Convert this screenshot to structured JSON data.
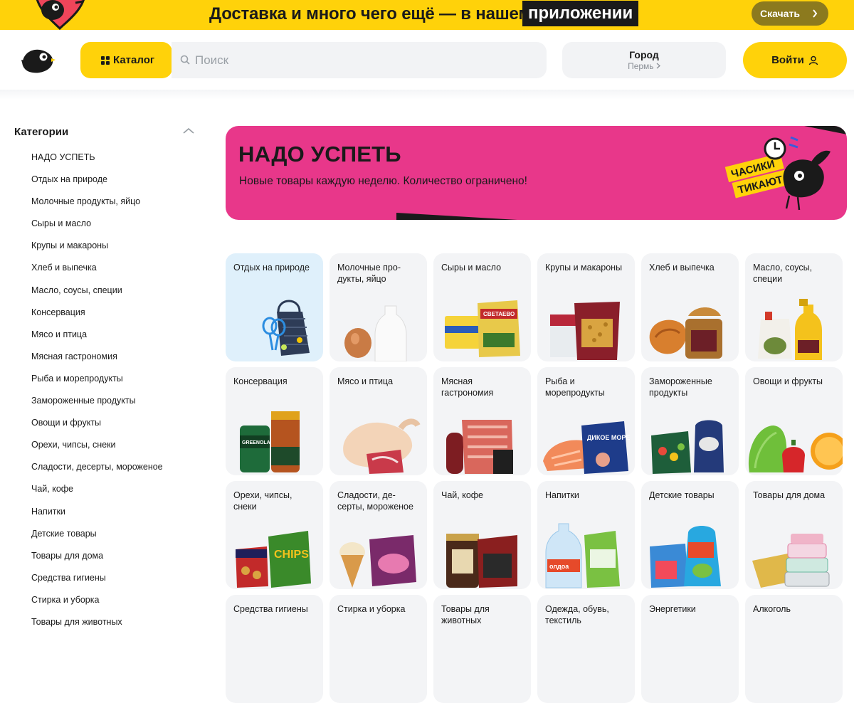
{
  "promo": {
    "text": "Доставка и много чего ещё — в нашем",
    "highlight": "приложении",
    "button": "Скачать"
  },
  "header": {
    "catalog_label": "Каталог",
    "search_placeholder": "Поиск",
    "city_label": "Город",
    "city_value": "Пермь",
    "login_label": "Войти"
  },
  "sidebar": {
    "title": "Категории",
    "items": [
      "НАДО УСПЕТЬ",
      "Отдых на природе",
      "Молочные продукты, яйцо",
      "Сыры и масло",
      "Крупы и макароны",
      "Хлеб и выпечка",
      "Масло, соусы, специи",
      "Консервация",
      "Мясо и птица",
      "Мясная гастрономия",
      "Рыба и морепродукты",
      "Замороженные продукты",
      "Овощи и фрукты",
      "Орехи, чипсы, снеки",
      "Сладости, десерты, мороженое",
      "Чай, кофе",
      "Напитки",
      "Детские товары",
      "Товары для дома",
      "Средства гигиены",
      "Стирка и уборка",
      "Товары для животных"
    ]
  },
  "hero": {
    "title": "НАДО УСПЕТЬ",
    "subtitle": "Новые товары каждую неделю. Количество ограничено!",
    "badge_line1": "ЧАСИКИ",
    "badge_line2": "ТИКАЮТ"
  },
  "tiles": [
    "Отдых на природе",
    "Молочные про-\nдукты, яйцо",
    "Сыры и масло",
    "Крупы и макароны",
    "Хлеб и выпечка",
    "Масло, соусы,\nспеции",
    "Консервация",
    "Мясо и птица",
    "Мясная\nгастрономия",
    "Рыба и\nморепродукты",
    "Замороженные\nпродукты",
    "Овощи и фрукты",
    "Орехи, чипсы,\nснеки",
    "Сладости, де-\nсерты, мороженое",
    "Чай, кофе",
    "Напитки",
    "Детские товары",
    "Товары для дома",
    "Средства гигиены",
    "Стирка и уборка",
    "Товары для\nживотных",
    "Одежда, обувь,\nтекстиль",
    "Энергетики",
    "Алкоголь"
  ],
  "tile_art_text": {
    "sveta": "СВЕТАЕВО",
    "greenola": "GREENOLA",
    "more": "ДИКОЕ МОРЕ",
    "chips": "CHIPS",
    "oldoa": "олдоа"
  },
  "colors": {
    "brand_yellow": "#ffd20a",
    "hero_pink": "#e8378a",
    "tile_bg": "#f3f4f6",
    "tile_highlight": "#dff0fb"
  }
}
